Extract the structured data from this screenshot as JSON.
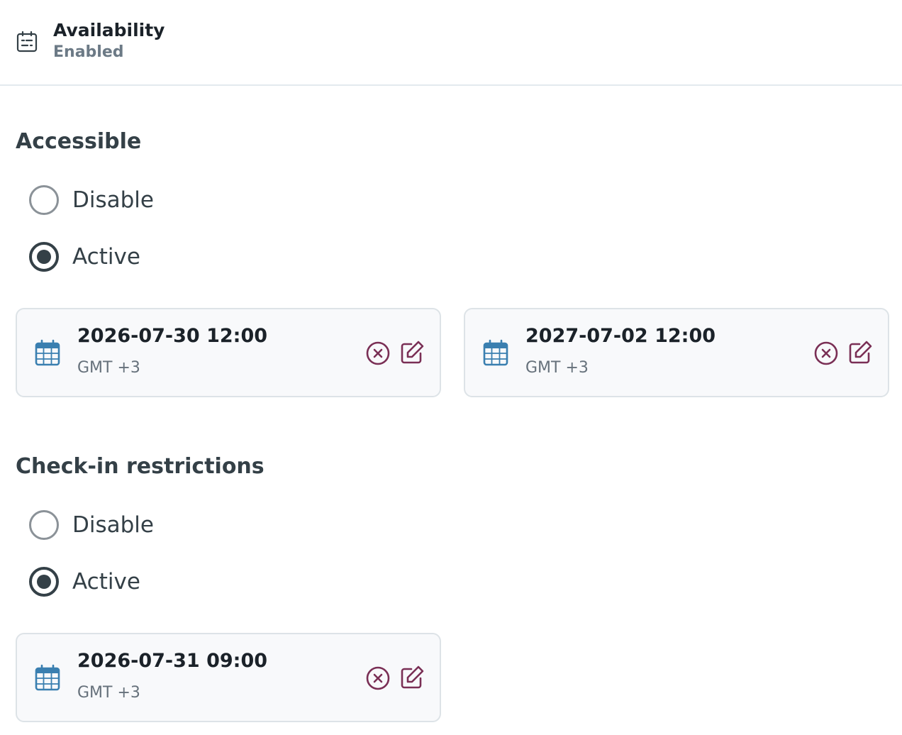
{
  "header": {
    "title": "Availability",
    "subtitle": "Enabled",
    "icon": "calendar-list-icon"
  },
  "accessible": {
    "title": "Accessible",
    "options": [
      {
        "label": "Disable",
        "checked": false
      },
      {
        "label": "Active",
        "checked": true
      }
    ],
    "dates": [
      {
        "datetime": "2026-07-30 12:00",
        "timezone": "GMT +3"
      },
      {
        "datetime": "2027-07-02 12:00",
        "timezone": "GMT +3"
      }
    ]
  },
  "checkin": {
    "title": "Check-in restrictions",
    "options": [
      {
        "label": "Disable",
        "checked": false
      },
      {
        "label": "Active",
        "checked": true
      }
    ],
    "dates": [
      {
        "datetime": "2026-07-31 09:00",
        "timezone": "GMT +3"
      }
    ]
  },
  "colors": {
    "calendar_icon": "#3a7fb0",
    "action_icon": "#7a2f55",
    "text_dark": "#1b2229",
    "text_muted": "#66717b"
  }
}
